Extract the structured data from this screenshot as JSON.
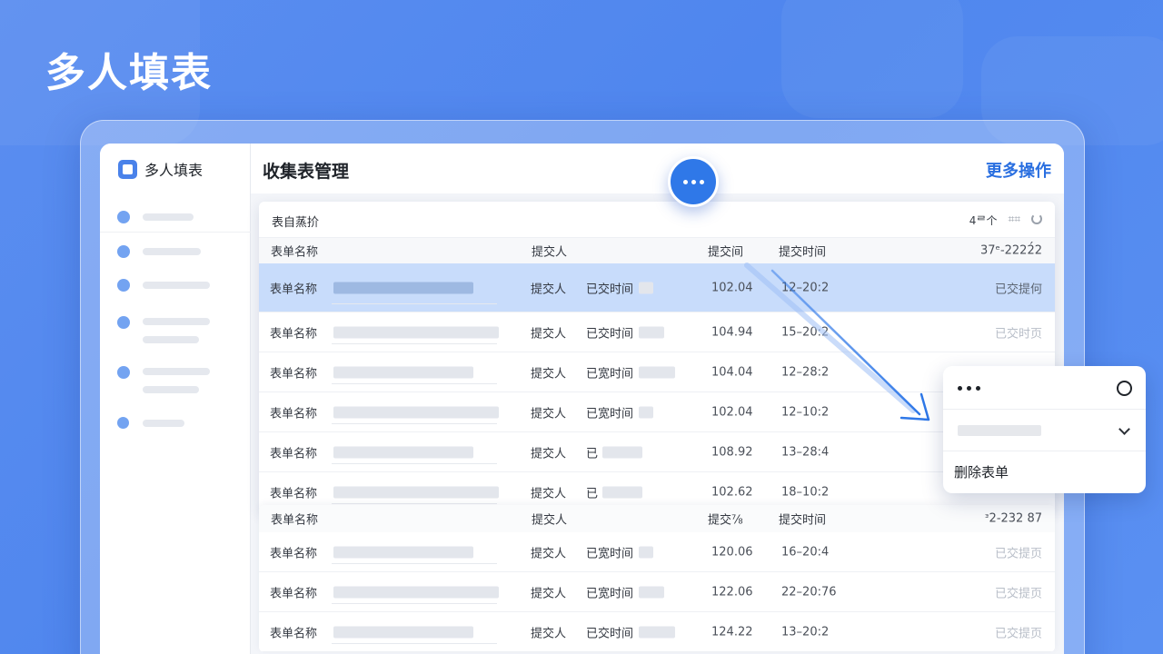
{
  "hero": {
    "title": "多人填表"
  },
  "sidebar": {
    "brand": "多人填表"
  },
  "header": {
    "title": "收集表管理",
    "more_actions": "更多操作"
  },
  "card": {
    "title": "表自蒸扴",
    "tools": {
      "count": "4ᄅ个",
      "extra": "⌗⌗"
    }
  },
  "columns": {
    "name": "表单名称",
    "submitter": "提交人",
    "submit_count": "提交间",
    "submit_time": "提交时间",
    "right": "37ᵉ-2222́2"
  },
  "rows": [
    {
      "name": "表单名称",
      "submitter": "提交人",
      "meta": "已交时间",
      "num": "102.04",
      "date": "12–20:2",
      "status": "已交提何"
    },
    {
      "name": "表单名称",
      "submitter": "提交人",
      "meta": "已交时间",
      "num": "104.94",
      "date": "15–20:2",
      "status": "已交时页"
    },
    {
      "name": "表单名称",
      "submitter": "提交人",
      "meta": "已宽时间",
      "num": "104.04",
      "date": "12–28:2",
      "status": ""
    },
    {
      "name": "表单名称",
      "submitter": "提交人",
      "meta": "已宽时间",
      "num": "102.04",
      "date": "12–10:2",
      "status": ""
    },
    {
      "name": "表单名称",
      "submitter": "提交人",
      "meta": "已",
      "num": "108.92",
      "date": "13–28:4",
      "status": ""
    },
    {
      "name": "表单名称",
      "submitter": "提交人",
      "meta": "已",
      "num": "102.62",
      "date": "18–10:2",
      "status": ""
    }
  ],
  "columns2": {
    "name": "表单名称",
    "submitter": "提交人",
    "submit_count": "提交⅞",
    "submit_time": "提交时间",
    "right": "ᵌ2-232 87"
  },
  "rows2": [
    {
      "name": "表单名称",
      "submitter": "提交人",
      "meta": "已宽时间",
      "num": "120.06",
      "date": "16–20:4",
      "status": "已交提页"
    },
    {
      "name": "表单名称",
      "submitter": "提交人",
      "meta": "已宽时间",
      "num": "122.06",
      "date": "22–20:76",
      "status": "已交提页"
    },
    {
      "name": "表单名称",
      "submitter": "提交人",
      "meta": "已交时间",
      "num": "124.22",
      "date": "13–20:2",
      "status": "已交提页"
    }
  ],
  "popup": {
    "delete_label": "删除表单"
  },
  "colors": {
    "accent": "#2f78e8",
    "selected_row": "#c8dcfb",
    "background": "#5b8ef0"
  }
}
